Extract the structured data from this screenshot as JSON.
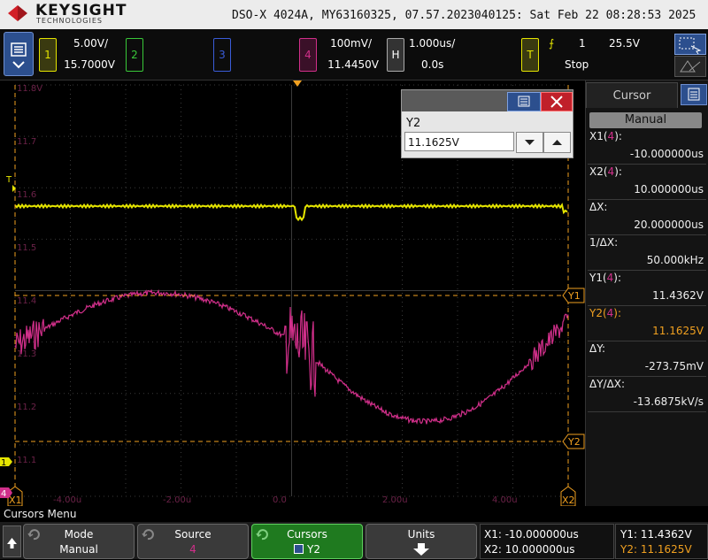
{
  "header": {
    "brand": "KEYSIGHT",
    "brand_sub": "TECHNOLOGIES",
    "model_line": "DSO-X 4024A, MY63160325, 07.57.2023040125: Sat Feb 22 08:28:53 2025"
  },
  "channels": {
    "ch1": {
      "num": "1",
      "scale": "5.00V/",
      "offset": "15.7000V",
      "color": "#e5e500"
    },
    "ch2": {
      "num": "2",
      "color": "#39c839"
    },
    "ch3": {
      "num": "3",
      "color": "#3a5cd8"
    },
    "ch4": {
      "num": "4",
      "scale": "100mV/",
      "offset": "11.4450V",
      "color": "#d12f8a"
    },
    "horizontal": {
      "key": "H",
      "scale": "1.000us/",
      "delay": "0.0s"
    },
    "trigger": {
      "key": "T",
      "symbol": "⨍",
      "source": "1",
      "level": "25.5V",
      "status": "Stop"
    }
  },
  "graticule": {
    "y_labels": [
      "11.8V",
      "11.7",
      "11.6",
      "11.5",
      "11.4",
      "11.3",
      "11.2",
      "11.1"
    ],
    "x_labels": [
      "-4.00u",
      "-2.00u",
      "0.0",
      "2.00u",
      "4.00u"
    ],
    "markers": {
      "x1": "X1",
      "x2": "X2",
      "y1": "Y1",
      "y2": "Y2",
      "ch1": "1",
      "ch4": "4",
      "trig": "T"
    }
  },
  "y2_dialog": {
    "title": "Y2",
    "value": "11.1625V"
  },
  "cursor_panel": {
    "tab": "Cursor",
    "mode": "Manual",
    "rows": [
      {
        "label_pre": "X1(",
        "label_src": "4",
        "label_post": "):",
        "value": "-10.000000us"
      },
      {
        "label_pre": "X2(",
        "label_src": "4",
        "label_post": "):",
        "value": "10.000000us"
      },
      {
        "label_pre": "ΔX:",
        "label_src": "",
        "label_post": "",
        "value": "20.000000us"
      },
      {
        "label_pre": "1/ΔX:",
        "label_src": "",
        "label_post": "",
        "value": "50.000kHz"
      },
      {
        "label_pre": "Y1(",
        "label_src": "4",
        "label_post": "):",
        "value": "11.4362V"
      },
      {
        "label_pre": "Y2(",
        "label_src": "4",
        "label_post": "):",
        "value": "11.1625V"
      },
      {
        "label_pre": "ΔY:",
        "label_src": "",
        "label_post": "",
        "value": "-273.75mV"
      },
      {
        "label_pre": "ΔY/ΔX:",
        "label_src": "",
        "label_post": "",
        "value": "-13.6875kV/s"
      }
    ]
  },
  "softkeys": {
    "menu_title": "Cursors Menu",
    "mode": {
      "title": "Mode",
      "value": "Manual"
    },
    "source": {
      "title": "Source",
      "value": "4"
    },
    "cursors": {
      "title": "Cursors",
      "value": "Y2"
    },
    "units": {
      "title": "Units"
    }
  },
  "readouts": {
    "x1": "X1: -10.000000us",
    "x2": "X2: 10.000000us",
    "y1": "Y1: 11.4362V",
    "y2": "Y2: 11.1625V"
  },
  "colors": {
    "accent_orange": "#f0a020",
    "ch1": "#e5e500",
    "ch4": "#d12f8a",
    "active_green": "#2a8a2a"
  }
}
